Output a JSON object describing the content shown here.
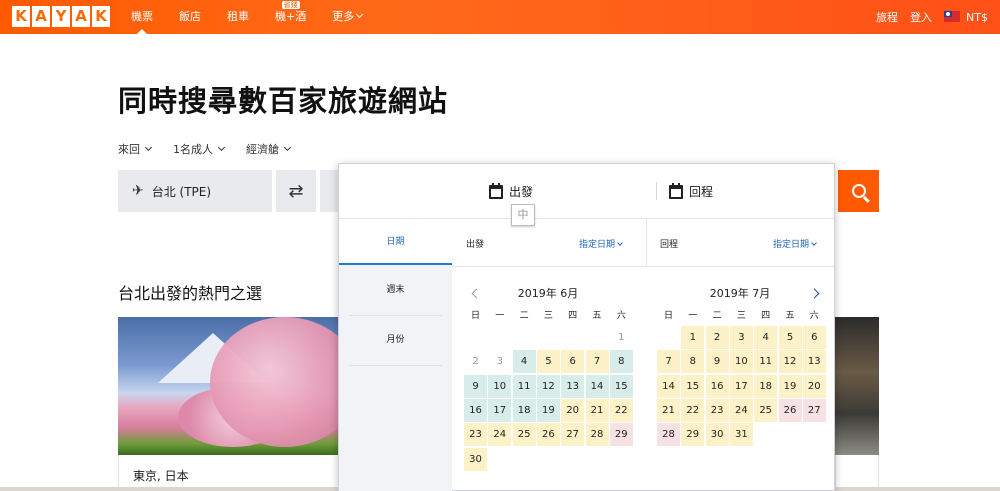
{
  "header": {
    "logo_letters": [
      "K",
      "A",
      "Y",
      "A",
      "K"
    ],
    "nav": [
      {
        "label": "機票",
        "active": true
      },
      {
        "label": "飯店"
      },
      {
        "label": "租車"
      },
      {
        "label": "機+酒",
        "badge": "省錢"
      },
      {
        "label": "更多"
      }
    ],
    "trips": "旅程",
    "login": "登入",
    "currency": "NT$"
  },
  "hero": {
    "title": "同時搜尋數百家旅遊網站",
    "trip_type": "來回",
    "passengers": "1名成人",
    "cabin": "經濟艙",
    "origin": "台北 (TPE)",
    "swap_icon": "⇄"
  },
  "popular": {
    "title": "台北出發的熱門之選",
    "card_city": "東京, 日本"
  },
  "picker": {
    "depart_label": "出發",
    "return_label": "回程",
    "ime_hint": "中",
    "tabs": [
      "日期",
      "週末",
      "月份"
    ],
    "depart_col": "出發",
    "return_col": "回程",
    "exact_date": "指定日期",
    "weekdays": [
      "日",
      "一",
      "二",
      "三",
      "四",
      "五",
      "六"
    ],
    "months": [
      {
        "title": "2019年 6月",
        "rows": [
          [
            null,
            null,
            null,
            null,
            null,
            null,
            {
              "d": "1",
              "s": "past"
            }
          ],
          [
            {
              "d": "2",
              "s": "past"
            },
            {
              "d": "3",
              "s": "past"
            },
            {
              "d": "4",
              "s": "g"
            },
            {
              "d": "5",
              "s": "y"
            },
            {
              "d": "6",
              "s": "y"
            },
            {
              "d": "7",
              "s": "y"
            },
            {
              "d": "8",
              "s": "g"
            }
          ],
          [
            {
              "d": "9",
              "s": "g"
            },
            {
              "d": "10",
              "s": "g"
            },
            {
              "d": "11",
              "s": "g"
            },
            {
              "d": "12",
              "s": "g"
            },
            {
              "d": "13",
              "s": "g"
            },
            {
              "d": "14",
              "s": "g"
            },
            {
              "d": "15",
              "s": "g"
            }
          ],
          [
            {
              "d": "16",
              "s": "g"
            },
            {
              "d": "17",
              "s": "g"
            },
            {
              "d": "18",
              "s": "g"
            },
            {
              "d": "19",
              "s": "g"
            },
            {
              "d": "20",
              "s": "y"
            },
            {
              "d": "21",
              "s": "y"
            },
            {
              "d": "22",
              "s": "y"
            }
          ],
          [
            {
              "d": "23",
              "s": "y"
            },
            {
              "d": "24",
              "s": "y"
            },
            {
              "d": "25",
              "s": "y"
            },
            {
              "d": "26",
              "s": "y"
            },
            {
              "d": "27",
              "s": "y"
            },
            {
              "d": "28",
              "s": "y"
            },
            {
              "d": "29",
              "s": "p"
            }
          ],
          [
            {
              "d": "30",
              "s": "y"
            },
            null,
            null,
            null,
            null,
            null,
            null
          ]
        ]
      },
      {
        "title": "2019年 7月",
        "rows": [
          [
            null,
            {
              "d": "1",
              "s": "y"
            },
            {
              "d": "2",
              "s": "y"
            },
            {
              "d": "3",
              "s": "y"
            },
            {
              "d": "4",
              "s": "y"
            },
            {
              "d": "5",
              "s": "y"
            },
            {
              "d": "6",
              "s": "y"
            }
          ],
          [
            {
              "d": "7",
              "s": "y"
            },
            {
              "d": "8",
              "s": "y"
            },
            {
              "d": "9",
              "s": "y"
            },
            {
              "d": "10",
              "s": "y"
            },
            {
              "d": "11",
              "s": "y"
            },
            {
              "d": "12",
              "s": "y"
            },
            {
              "d": "13",
              "s": "y"
            }
          ],
          [
            {
              "d": "14",
              "s": "y"
            },
            {
              "d": "15",
              "s": "y"
            },
            {
              "d": "16",
              "s": "y"
            },
            {
              "d": "17",
              "s": "y"
            },
            {
              "d": "18",
              "s": "y"
            },
            {
              "d": "19",
              "s": "y"
            },
            {
              "d": "20",
              "s": "y"
            }
          ],
          [
            {
              "d": "21",
              "s": "y"
            },
            {
              "d": "22",
              "s": "y"
            },
            {
              "d": "23",
              "s": "y"
            },
            {
              "d": "24",
              "s": "y"
            },
            {
              "d": "25",
              "s": "y"
            },
            {
              "d": "26",
              "s": "p"
            },
            {
              "d": "27",
              "s": "p"
            }
          ],
          [
            {
              "d": "28",
              "s": "p"
            },
            {
              "d": "29",
              "s": "y"
            },
            {
              "d": "30",
              "s": "y"
            },
            {
              "d": "31",
              "s": "y"
            },
            null,
            null,
            null
          ]
        ]
      }
    ]
  }
}
